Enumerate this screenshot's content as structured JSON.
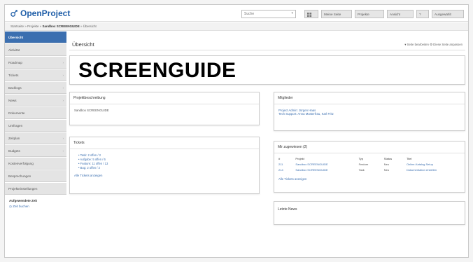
{
  "app": {
    "name": "OpenProject",
    "brand_color": "#1f5ea8",
    "accent_color": "#3b6fb0"
  },
  "topbar": {
    "search_placeholder": "Suche",
    "buttons": [
      "",
      "Meine Seite",
      "Projekte",
      "Ansicht",
      "?",
      "Ausgewählt"
    ]
  },
  "breadcrumb": {
    "prefix": "Startseite » Projekte » ",
    "current": "Sandbox SCREENGUIDE",
    "suffix": " » Übersicht"
  },
  "sidebar": {
    "items": [
      {
        "label": "Übersicht",
        "active": true,
        "arrow": false
      },
      {
        "label": "Aktivität",
        "active": false,
        "arrow": false
      },
      {
        "label": "Roadmap",
        "active": false,
        "arrow": true
      },
      {
        "label": "Tickets",
        "active": false,
        "arrow": true
      },
      {
        "label": "Backlogs",
        "active": false,
        "arrow": true
      },
      {
        "label": "News",
        "active": false,
        "arrow": true
      },
      {
        "label": "Dokumente",
        "active": false,
        "arrow": false
      },
      {
        "label": "Umfragen",
        "active": false,
        "arrow": false
      },
      {
        "label": "Zeitplan",
        "active": false,
        "arrow": true
      },
      {
        "label": "Budgets",
        "active": false,
        "arrow": true
      },
      {
        "label": "Kostenverfolgung",
        "active": false,
        "arrow": false
      },
      {
        "label": "Besprechungen",
        "active": false,
        "arrow": false
      },
      {
        "label": "Projekteinstellungen",
        "active": false,
        "arrow": false
      }
    ],
    "section_title": "Aufgewendete Zeit",
    "section_link": "Zeit buchen"
  },
  "main": {
    "title": "Übersicht",
    "actions": "▾ Seite bearbeiten   ⚙ Diese Seite anpassen",
    "hero": "SCREENGUIDE",
    "description": {
      "title": "Projektbeschreibung",
      "body": "Sandbox SCREENGUIDE"
    },
    "tickets": {
      "title": "Tickets",
      "items": [
        "Task: 2 offen / 2",
        "Aufgabe: 5 offen / 6",
        "Feature: 11 offen / 13",
        "Bug: 2 offen / 2"
      ],
      "link": "Alle Tickets anzeigen"
    },
    "members": {
      "title": "Mitglieder",
      "lines": [
        "Project Admin: Jürgen Haas",
        "Tech Support: Anna Musterfrau, Karl Fritz"
      ]
    },
    "assigned": {
      "title": "Mir zugewiesen (2)",
      "headers": [
        "#",
        "Projekt",
        "Typ",
        "Status",
        "Titel"
      ],
      "rows": [
        [
          "211",
          "Sandbox SCREENGUIDE",
          "Feature",
          "Neu",
          "Online-Katalog Setup"
        ],
        [
          "214",
          "Sandbox SCREENGUIDE",
          "Task",
          "Neu",
          "Dokumentation erstellen"
        ]
      ],
      "link": "Alle Tickets anzeigen"
    },
    "news": {
      "title": "Letzte News"
    }
  }
}
